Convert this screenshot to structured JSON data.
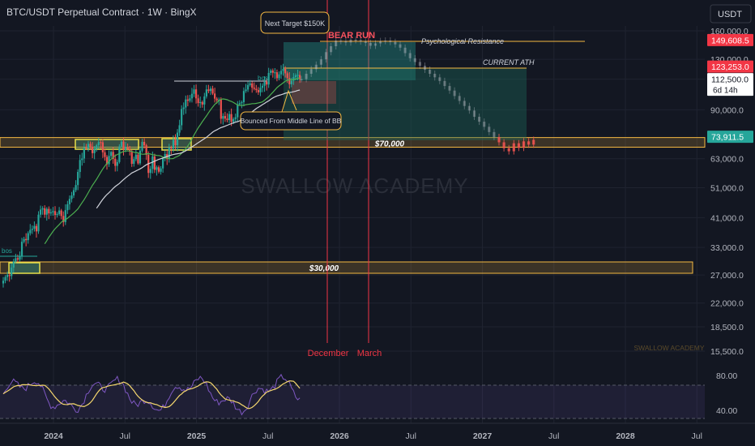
{
  "header": {
    "title": "BTC/USDT Perpetual Contract · 1W · BingX",
    "currency": "USDT"
  },
  "watermark": {
    "main": "SWALLOW ACADEMY",
    "corner": "SWALLOW ACADEMY"
  },
  "colors": {
    "background": "#131722",
    "bull": "#26a69a",
    "bear": "#ef5350",
    "gold": "#f5b942",
    "projection_zone": "#1e6b5c",
    "rsi": "#7e57c2",
    "rsi_ma": "#f5d76e",
    "event_line": "#f23645"
  },
  "chart_data": {
    "type": "candlestick",
    "title": "BTC/USDT Perpetual Contract · 1W · BingX",
    "scale": "log",
    "y_ticks": [
      160000,
      130000,
      112500,
      90000,
      63000,
      51000,
      41000,
      33000,
      27000,
      22000,
      18500,
      15500
    ],
    "y_tick_labels": [
      "160,000.0",
      "130,000.0",
      "112,500.0",
      "90,000.0",
      "63,000.0",
      "51,000.0",
      "41,000.0",
      "33,000.0",
      "27,000.0",
      "22,000.0",
      "18,500.0",
      "15,500.0"
    ],
    "x_ticks": [
      "2024",
      "Jul",
      "2025",
      "Jul",
      "2026",
      "Jul",
      "2027",
      "Jul",
      "2028",
      "Jul"
    ],
    "price_labels": [
      {
        "id": "resistance",
        "value": 149608.5,
        "text": "149,608.5",
        "color": "#f23645"
      },
      {
        "id": "ath",
        "value": 123253,
        "text": "123,253.0",
        "color": "#f23645"
      },
      {
        "id": "current",
        "value": 112500,
        "text": "112,500.0",
        "sub": "6d 14h",
        "color": "#ffffff"
      },
      {
        "id": "support",
        "value": 73911.5,
        "text": "73,911.5",
        "color": "#26a69a"
      }
    ],
    "zones": [
      {
        "label": "$70,000",
        "low": 68500,
        "high": 73500
      },
      {
        "label": "$30,000",
        "low": 28000,
        "high": 30000
      }
    ],
    "annotations": {
      "next_target": "Next Target $150K",
      "bear_run": "BEAR RUN",
      "psychological_resistance": "Psychological Resistance",
      "current_ath": "CURRENT ATH",
      "bounced": "Bounced From Middle Line of BB",
      "bos_1": "bos",
      "bos_2": "bos",
      "december": "December",
      "march": "March"
    },
    "rsi": {
      "ticks": [
        80,
        40
      ],
      "tick_labels": [
        "80.00",
        "40.00"
      ]
    },
    "price_series_weekly_close": [
      25900,
      26600,
      27000,
      26800,
      28500,
      29800,
      30500,
      30200,
      31000,
      34400,
      35100,
      34800,
      36600,
      37500,
      37800,
      38600,
      37100,
      41900,
      43500,
      43900,
      41900,
      43700,
      42300,
      42600,
      43000,
      41800,
      42100,
      43200,
      41500,
      39700,
      43300,
      45200,
      47000,
      48200,
      50100,
      52000,
      57200,
      62400,
      63100,
      68200,
      67900,
      70200,
      68800,
      65600,
      67800,
      69500,
      71100,
      71000,
      66000,
      63800,
      60500,
      64300,
      66200,
      62900,
      59800,
      61500,
      68900,
      71400,
      67100,
      68500,
      67800,
      66300,
      60700,
      62800,
      64900,
      60900,
      66800,
      71200,
      69500,
      64800,
      56800,
      58500,
      64100,
      58100,
      59200,
      57300,
      58700,
      63300,
      65200,
      62800,
      68300,
      67900,
      72300,
      69500,
      76200,
      80400,
      90500,
      91500,
      97000,
      96100,
      97800,
      101100,
      104400,
      97800,
      94500,
      95200,
      93500,
      99200,
      104400,
      103200,
      105000,
      101300,
      97600,
      96400,
      96800,
      84300,
      86000,
      84400,
      83500,
      87200,
      82400,
      84100,
      85200,
      93600,
      94400,
      95100,
      103200,
      104300,
      107800,
      109100,
      105700,
      104800,
      103900,
      102200,
      105600,
      107200,
      110400,
      108200,
      117700,
      119800,
      117900,
      118300,
      113300,
      116500,
      119500,
      121200,
      117400,
      113400,
      108400,
      111200,
      114200,
      115700,
      116000,
      112700
    ],
    "projection": {
      "peak": 150000,
      "path": [
        112500,
        117000,
        121000,
        125000,
        130000,
        137000,
        143000,
        149000,
        148500,
        147000,
        150000,
        149500,
        148000,
        146500,
        143500,
        146000,
        148500,
        149000,
        147500,
        145000,
        141500,
        136000,
        131000,
        127500,
        124000,
        120500,
        117000,
        114000,
        111000,
        107000,
        103500,
        99500,
        96000,
        92500,
        89500,
        85500,
        82500,
        79500,
        76500,
        73800,
        71000,
        68000,
        66500,
        70500,
        68200,
        71500,
        69800,
        72300
      ]
    }
  }
}
